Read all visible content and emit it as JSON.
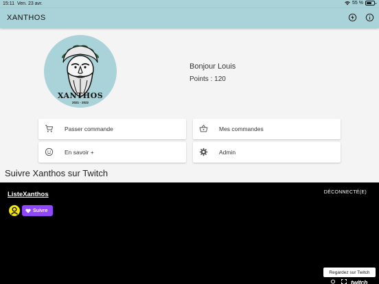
{
  "status_bar": {
    "time": "15:11",
    "date": "Ven. 23 avr.",
    "battery": "55 %",
    "battery_level": 0.55
  },
  "app_bar": {
    "title": "XANTHOS",
    "icons": [
      "bolt-circle-icon",
      "info-circle-icon"
    ]
  },
  "profile": {
    "logo": {
      "name": "XANTHOS",
      "years": "2021 - 2022"
    },
    "greeting": "Bonjour Louis",
    "points": "Points : 120"
  },
  "cards": [
    {
      "label": "Passer commande",
      "icon": "cart-icon"
    },
    {
      "label": "Mes commandes",
      "icon": "basket-icon"
    },
    {
      "label": "En savoir +",
      "icon": "smiley-icon"
    },
    {
      "label": "Admin",
      "icon": "gear-icon"
    }
  ],
  "section_title": "Suivre Xanthos sur Twitch",
  "twitch": {
    "channel": "ListeXanthos",
    "status": "DÉCONNECTÉ(E)",
    "follow_label": "Suivre",
    "watch_label": "Regardez sur Twitch",
    "brand": "twitch",
    "colors": {
      "follow": "#9147ff",
      "avatar": "#f2e60a"
    }
  },
  "colors": {
    "accent": "#a9d3d8",
    "background": "#f4f4f4"
  }
}
